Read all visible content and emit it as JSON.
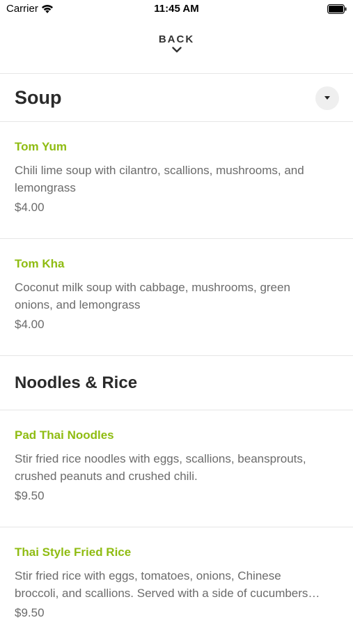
{
  "status_bar": {
    "carrier": "Carrier",
    "time": "11:45 AM"
  },
  "nav": {
    "back_label": "BACK"
  },
  "sections": [
    {
      "title": "Soup",
      "items": [
        {
          "name": "Tom Yum",
          "desc_line1": "Chili lime soup with cilantro, scallions, mushrooms, and",
          "desc_line2": "lemongrass",
          "price": "$4.00"
        },
        {
          "name": "Tom Kha",
          "desc_line1": "Coconut milk soup with cabbage, mushrooms, green",
          "desc_line2": "onions, and lemongrass",
          "price": "$4.00"
        }
      ]
    },
    {
      "title": "Noodles & Rice",
      "items": [
        {
          "name": "Pad Thai Noodles",
          "desc_line1": "Stir fried rice noodles with eggs, scallions, beansprouts,",
          "desc_line2": "crushed peanuts and crushed chili.",
          "price": "$9.50"
        },
        {
          "name": "Thai Style Fried Rice",
          "desc_line1": "Stir fried rice with eggs, tomatoes, onions, Chinese",
          "desc_line2": "broccoli, and scallions. Served with a side of cucumbers…",
          "price": "$9.50"
        }
      ]
    }
  ],
  "colors": {
    "accent": "#8fbc12",
    "text": "#6b6b6b",
    "divider": "#e6e6e6"
  }
}
